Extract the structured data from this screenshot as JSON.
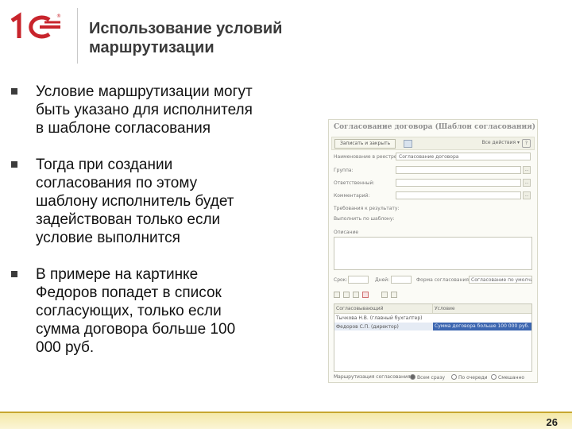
{
  "slide": {
    "title_lines": [
      "Использование условий",
      "маршрутизации"
    ],
    "page_number": "26"
  },
  "bullets": [
    {
      "lines": [
        "Условие маршрутизации могут",
        "быть указано для исполнителя",
        "в шаблоне согласования"
      ]
    },
    {
      "lines": [
        "Тогда при создании",
        "согласования по этому",
        "шаблону исполнитель будет",
        "задействован только если",
        "условие выполнится"
      ]
    },
    {
      "lines": [
        "В примере на картинке",
        "Федоров попадет в список",
        "согласующих, только если",
        "сумма договора больше 100",
        "000 руб."
      ]
    }
  ],
  "form": {
    "title": "Согласование договора (Шаблон согласования)",
    "toolbar": {
      "save_close": "Записать и закрыть",
      "actions_menu": "Все действия ▾",
      "help": "?"
    },
    "fields": [
      {
        "label": "Наименование в реестре:",
        "value": "Согласование договора",
        "has_pick": false
      },
      {
        "label": "Группа:",
        "value": "",
        "has_pick": true
      },
      {
        "label": "Ответственный:",
        "value": "",
        "has_pick": true
      },
      {
        "label": "Комментарий:",
        "value": "",
        "has_pick": true
      },
      {
        "label": "Требования к результату:",
        "value": "",
        "has_pick": false
      },
      {
        "label": "Выполнить по шаблону:",
        "value": "",
        "has_pick": false
      }
    ],
    "description_label": "Описание",
    "filter": {
      "label1": "Срок:",
      "label2": "Дней:",
      "label3": "Форма согласования:",
      "value3": "Согласование по умолчанию"
    },
    "table": {
      "headers": [
        "Согласовывающий",
        "Условие"
      ],
      "rows": [
        {
          "person": "Тычкова Н.В. (главный бухгалтер)",
          "condition": "",
          "selected": false
        },
        {
          "person": "Федоров С.П. (директор)",
          "condition": "Сумма договора больше 100 000 руб.",
          "selected": true
        }
      ]
    },
    "routing": {
      "label": "Маршрутизация согласования:",
      "options": [
        {
          "label": "Всем сразу",
          "selected": true
        },
        {
          "label": "По очереди",
          "selected": false
        },
        {
          "label": "Смешанно",
          "selected": false
        }
      ]
    }
  },
  "colors": {
    "brand_red": "#c8242c",
    "bottom_band": "#f4e9a8",
    "selection_blue": "#3c66b0"
  }
}
